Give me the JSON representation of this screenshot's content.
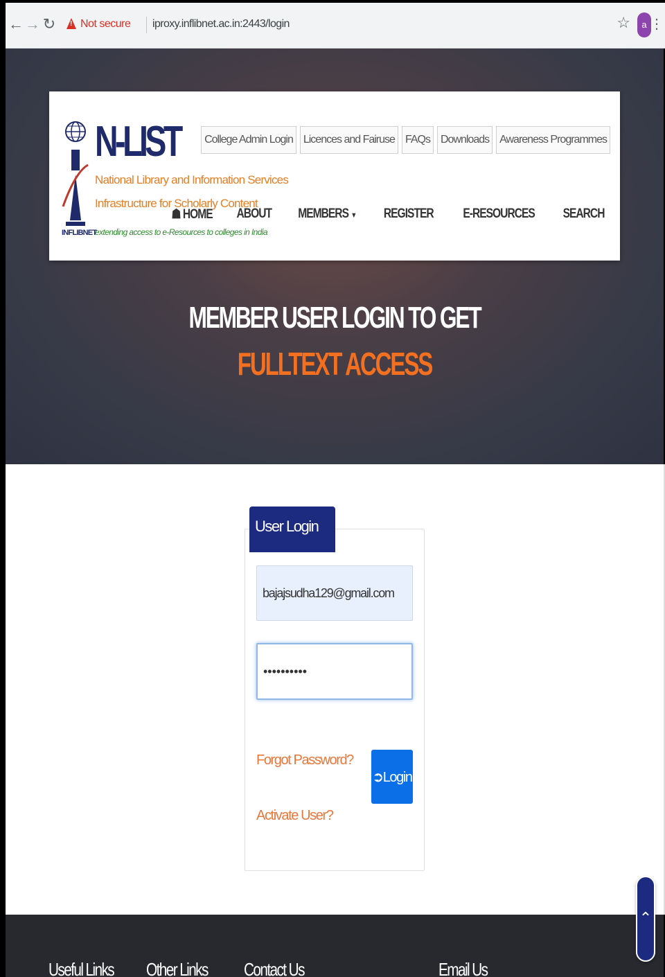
{
  "browser": {
    "back_icon": "back-arrow-icon",
    "forward_icon": "forward-arrow-icon",
    "reload_icon": "reload-icon",
    "not_secure": "Not secure",
    "url": "iproxy.inflibnet.ac.in:2443/login",
    "avatar_letter": "a"
  },
  "header": {
    "brand": "N-LIST",
    "tagline1": "National Library and Information Services",
    "tagline2": "Infrastructure for Scholarly Content",
    "tagline3": "extending access to e-Resources to colleges in India",
    "emblem_label": "INFLIBNET",
    "top_links": [
      "College Admin Login",
      "Licences and Fairuse",
      "FAQs",
      "Downloads",
      "Awareness Programmes"
    ],
    "nav": {
      "home": "HOME",
      "about": "ABOUT",
      "members": "MEMBERS",
      "register": "REGISTER",
      "eresources": "E-RESOURCES",
      "search": "SEARCH"
    }
  },
  "hero": {
    "line1": "MEMBER USER LOGIN TO GET",
    "line2": "FULLTEXT ACCESS"
  },
  "login": {
    "tab_label": "User Login",
    "email_value": "bajajsudha129@gmail.com",
    "password_value": "••••••••••",
    "forgot_label": "Forgot Password?",
    "activate_label": "Activate User?",
    "login_label": "Login"
  },
  "footer": {
    "useful_links": "Useful Links",
    "other_links": "Other Links",
    "contact_us": "Contact Us",
    "email_us": "Email Us"
  },
  "colors": {
    "brand_navy": "#1c2a80",
    "accent_orange": "#f37021",
    "login_blue": "#0b6fe8"
  }
}
